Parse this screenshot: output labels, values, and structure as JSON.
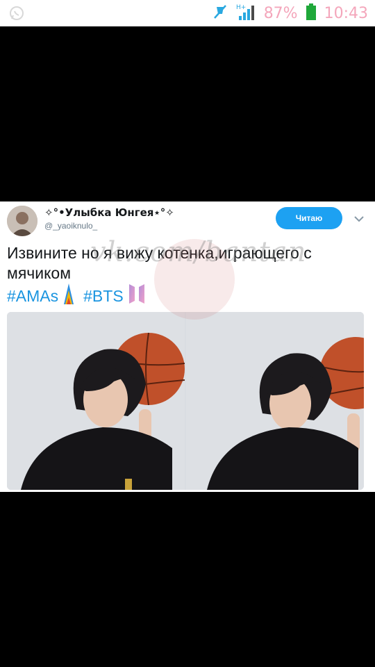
{
  "status_bar": {
    "battery_percent": "87%",
    "time": "10:43",
    "network_type": "H+",
    "icons": [
      "whatsapp-icon",
      "mute-icon",
      "signal-icon",
      "battery-icon"
    ],
    "accent_color": "#f4a6bb"
  },
  "tweet": {
    "display_name": "✧°•Улыбка Юнгея⋆°✧",
    "handle": "@_yaoiknulo_",
    "follow_label": "Читаю",
    "text": "Извините но я вижу котенка,играющего с мячиком",
    "hashtags": [
      "#AMAs",
      "#BTS"
    ],
    "link_color": "#1b95e0",
    "button_color": "#1da1f2"
  },
  "watermark": {
    "text": "vk.com/bantan"
  },
  "media": {
    "photos": [
      "photo-1",
      "photo-2"
    ]
  }
}
